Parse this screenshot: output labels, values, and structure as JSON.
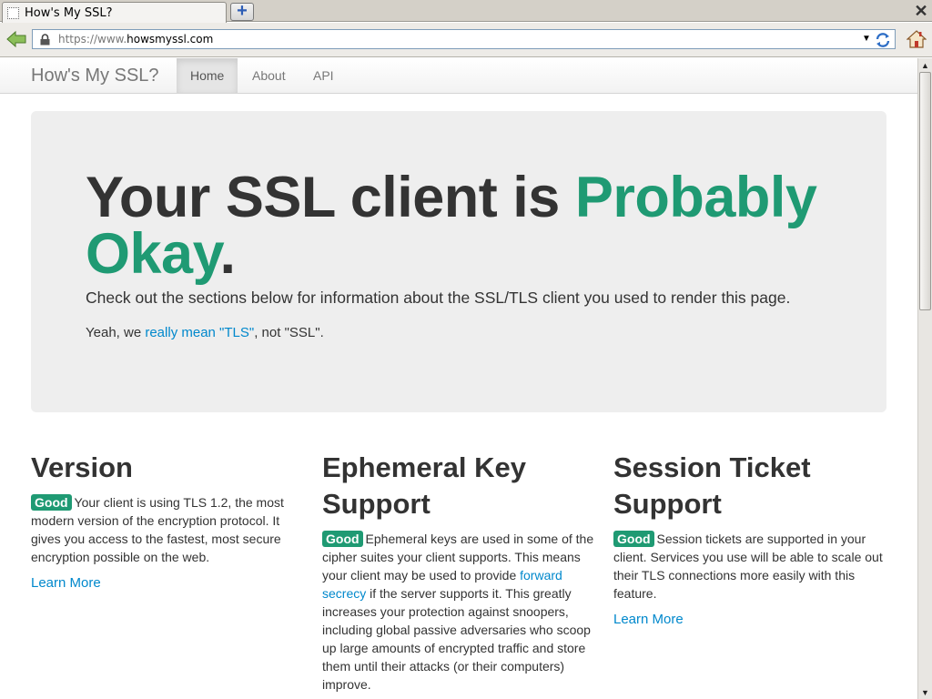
{
  "browser": {
    "tab_title": "How's My SSL?",
    "url_prefix": "https://www.",
    "url_domain": "howsmyssl.com"
  },
  "nav": {
    "brand": "How's My SSL?",
    "items": [
      {
        "label": "Home",
        "active": true
      },
      {
        "label": "About",
        "active": false
      },
      {
        "label": "API",
        "active": false
      }
    ]
  },
  "hero": {
    "title_prefix": "Your SSL client is ",
    "rating": "Probably Okay",
    "title_suffix": ".",
    "subtitle": "Check out the sections below for information about the SSL/TLS client you used to render this page.",
    "note_prefix": "Yeah, we ",
    "note_link": "really mean \"TLS\"",
    "note_suffix": ", not \"SSL\"."
  },
  "sections": {
    "version": {
      "title": "Version",
      "badge": "Good",
      "text": "Your client is using TLS 1.2, the most modern version of the encryption protocol. It gives you access to the fastest, most secure encryption possible on the web.",
      "link": "Learn More"
    },
    "ephemeral": {
      "title": "Ephemeral Key Support",
      "badge": "Good",
      "text_before": "Ephemeral keys are used in some of the cipher suites your client supports. This means your client may be used to provide ",
      "inline_link": "forward secrecy",
      "text_after": " if the server supports it. This greatly increases your protection against snoopers, including global passive adversaries who scoop up large amounts of encrypted traffic and store them until their attacks (or their computers) improve."
    },
    "session": {
      "title": "Session Ticket Support",
      "badge": "Good",
      "text": "Session tickets are supported in your client. Services you use will be able to scale out their TLS connections more easily with this feature.",
      "link": "Learn More"
    }
  },
  "colors": {
    "rating": "#1f9a73",
    "badge": "#1f9a73",
    "link": "#0088cc"
  }
}
